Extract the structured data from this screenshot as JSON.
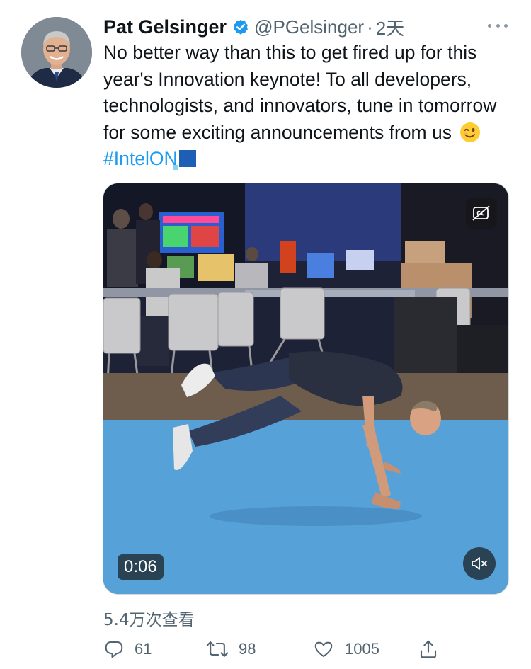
{
  "author": {
    "name": "Pat Gelsinger",
    "handle": "@PGelsinger",
    "separator": "·",
    "time": "2天"
  },
  "tweet": {
    "text_main": "No better way than this to get fired up for this year's Innovation keynote! To all developers, technologists, and innovators, tune in tomorrow for some exciting announcements from us",
    "hashtag": "#IntelON"
  },
  "media": {
    "duration": "0:06"
  },
  "views": "5.4万次查看",
  "actions": {
    "replies": "61",
    "retweets": "98",
    "likes": "1005"
  },
  "icons": {
    "verified": "verified-badge-icon",
    "more": "more-dots-icon",
    "cc": "closed-captions-icon",
    "mute": "muted-speaker-icon",
    "reply": "reply-icon",
    "retweet": "retweet-icon",
    "like": "heart-icon",
    "share": "share-icon"
  },
  "colors": {
    "accent": "#1d9bf0",
    "secondary_text": "#536471"
  }
}
